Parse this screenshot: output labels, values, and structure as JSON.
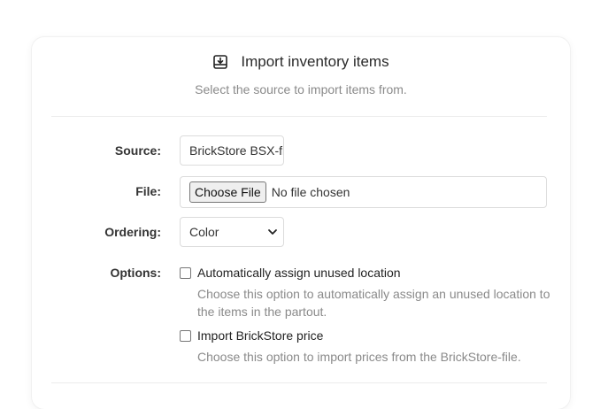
{
  "header": {
    "title": "Import inventory items",
    "subtitle": "Select the source to import items from.",
    "icon": "import-tray-icon"
  },
  "form": {
    "source": {
      "label": "Source:",
      "value": "BrickStore BSX-file"
    },
    "file": {
      "label": "File:",
      "button_label": "Choose File",
      "status": "No file chosen"
    },
    "ordering": {
      "label": "Ordering:",
      "value": "Color"
    },
    "options": {
      "label": "Options:",
      "items": [
        {
          "label": "Automatically assign unused location",
          "help": "Choose this option to automatically assign an unused location to the items in the partout.",
          "checked": false
        },
        {
          "label": "Import BrickStore price",
          "help": "Choose this option to import prices from the BrickStore-file.",
          "checked": false
        }
      ]
    }
  }
}
